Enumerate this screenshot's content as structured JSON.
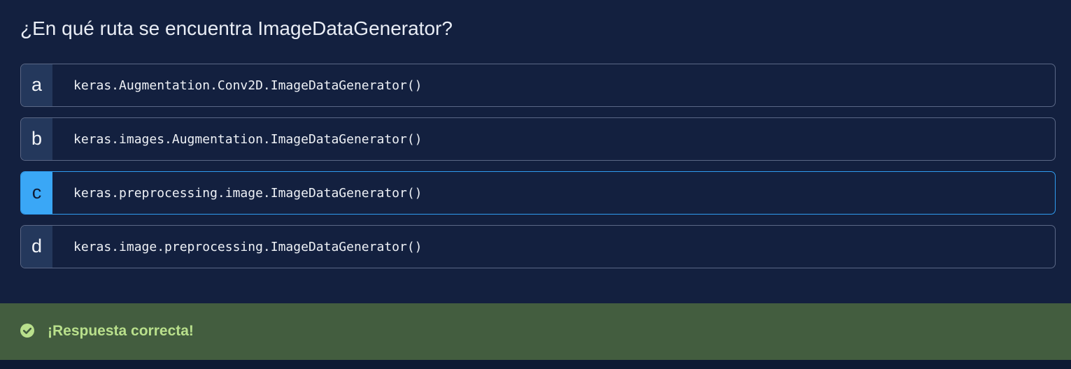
{
  "question": {
    "text": "¿En qué ruta se encuentra ImageDataGenerator?"
  },
  "options": [
    {
      "letter": "a",
      "code": "keras.Augmentation.Conv2D.ImageDataGenerator()",
      "selected": false
    },
    {
      "letter": "b",
      "code": "keras.images.Augmentation.ImageDataGenerator()",
      "selected": false
    },
    {
      "letter": "c",
      "code": "keras.preprocessing.image.ImageDataGenerator()",
      "selected": true
    },
    {
      "letter": "d",
      "code": "keras.image.preprocessing.ImageDataGenerator()",
      "selected": false
    }
  ],
  "feedback": {
    "icon": "check-circle-icon",
    "text": "¡Respuesta correcta!",
    "status": "correct"
  },
  "colors": {
    "background": "#13203f",
    "letter_box": "#24385c",
    "selected_accent": "#3aa7f6",
    "selected_border": "#2f9cf0",
    "success_bar": "#435d3f",
    "success_text": "#b9e08c"
  }
}
